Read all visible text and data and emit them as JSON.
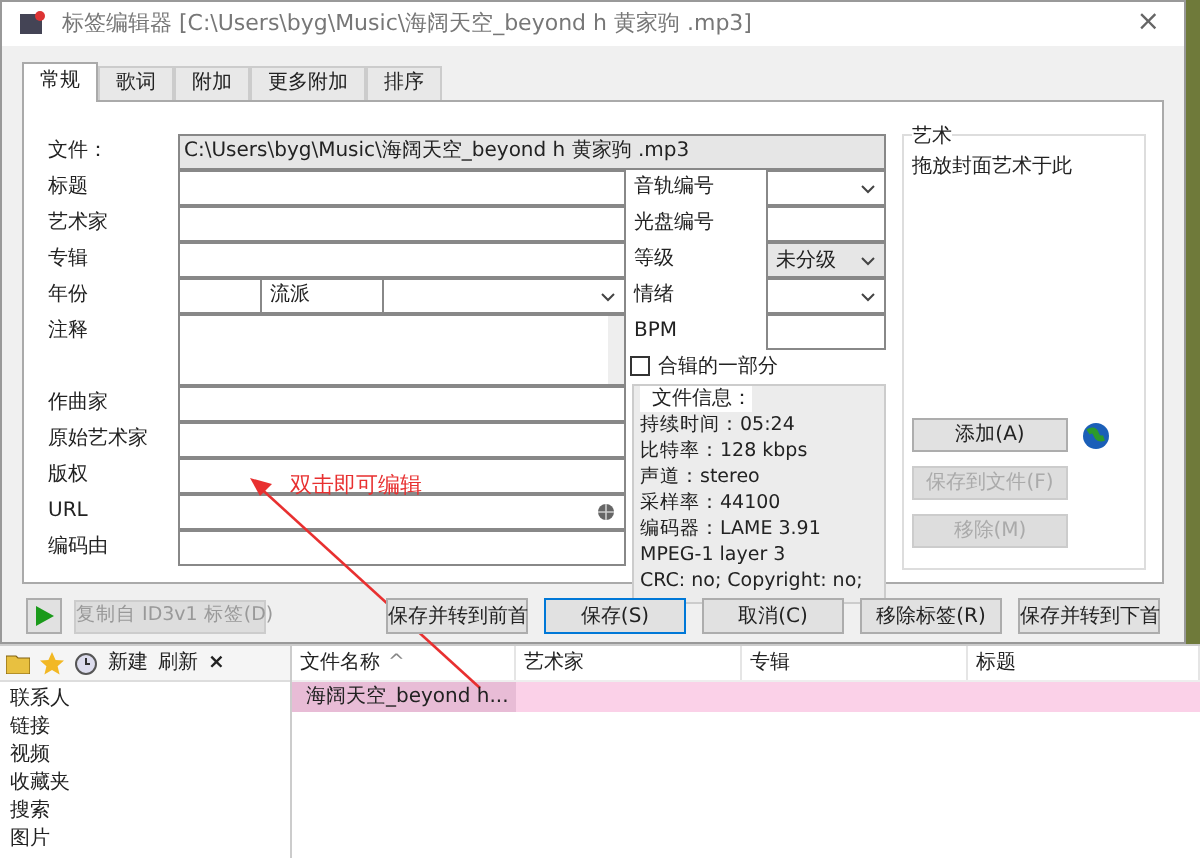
{
  "window": {
    "title": "标签编辑器 [C:\\Users\\byg\\Music\\海阔天空_beyond h 黄家驹 .mp3]",
    "close": "×"
  },
  "tabs": [
    {
      "label": "常规",
      "selected": true
    },
    {
      "label": "歌词",
      "selected": false
    },
    {
      "label": "附加",
      "selected": false
    },
    {
      "label": "更多附加",
      "selected": false
    },
    {
      "label": "排序",
      "selected": false
    }
  ],
  "file": {
    "label": "文件：",
    "path": "C:\\Users\\byg\\Music\\海阔天空_beyond h 黄家驹 .mp3"
  },
  "fields": [
    {
      "label": "标题",
      "kind": "text"
    },
    {
      "label": "艺术家",
      "kind": "text"
    },
    {
      "label": "专辑",
      "kind": "text"
    },
    {
      "label": "年份",
      "kind": "year",
      "genre_label": "流派"
    },
    {
      "label": "注释",
      "kind": "memo"
    }
  ],
  "right_fields": [
    {
      "label": "音轨编号",
      "kind": "dropdown"
    },
    {
      "label": "光盘编号",
      "kind": "text"
    },
    {
      "label": "等级",
      "kind": "dropdown",
      "value": "未分级"
    },
    {
      "label": "情绪",
      "kind": "dropdown"
    },
    {
      "label": "BPM",
      "kind": "text"
    }
  ],
  "compilation": {
    "label": "合辑的一部分",
    "checked": false
  },
  "file_info": {
    "title": "文件信息：",
    "lines": [
      "持续时间：05:24",
      "比特率：128 kbps",
      "声道：stereo",
      "采样率：44100",
      "编码器：LAME 3.91",
      "MPEG-1 layer 3",
      "CRC: no; Copyright: no;"
    ]
  },
  "lower_fields": [
    {
      "label": "作曲家",
      "kind": "text"
    },
    {
      "label": "原始艺术家",
      "kind": "text"
    },
    {
      "label": "版权",
      "kind": "text"
    },
    {
      "label": "URL",
      "kind": "url"
    },
    {
      "label": "编码由",
      "kind": "text"
    }
  ],
  "art": {
    "title": "艺术",
    "hint": "拖放封面艺术于此",
    "buttons": [
      {
        "label": "添加(A)",
        "disabled": false
      },
      {
        "label": "保存到文件(F)",
        "disabled": true
      },
      {
        "label": "移除(M)",
        "disabled": true
      }
    ]
  },
  "copy_button": {
    "label": "复制自 ID3v1 标签(D)",
    "disabled": true
  },
  "buttons": [
    {
      "label": "保存并转到前首",
      "selected": false
    },
    {
      "label": "保存(S)",
      "selected": true
    },
    {
      "label": "取消(C)",
      "selected": false
    },
    {
      "label": "移除标签(R)",
      "selected": false
    },
    {
      "label": "保存并转到下首",
      "selected": false
    }
  ],
  "annotation": "双击即可编辑",
  "explorer": {
    "toolbar": [
      "新建",
      "刷新"
    ],
    "close": "×",
    "sidebar": [
      "联系人",
      "链接",
      "视频",
      "收藏夹",
      "搜索",
      "图片"
    ],
    "columns": [
      {
        "label": "文件名称",
        "sort": "^"
      },
      {
        "label": "艺术家"
      },
      {
        "label": "专辑"
      },
      {
        "label": "标题"
      }
    ],
    "rows": [
      {
        "name": "海阔天空_beyond h...",
        "selected": true
      }
    ]
  }
}
